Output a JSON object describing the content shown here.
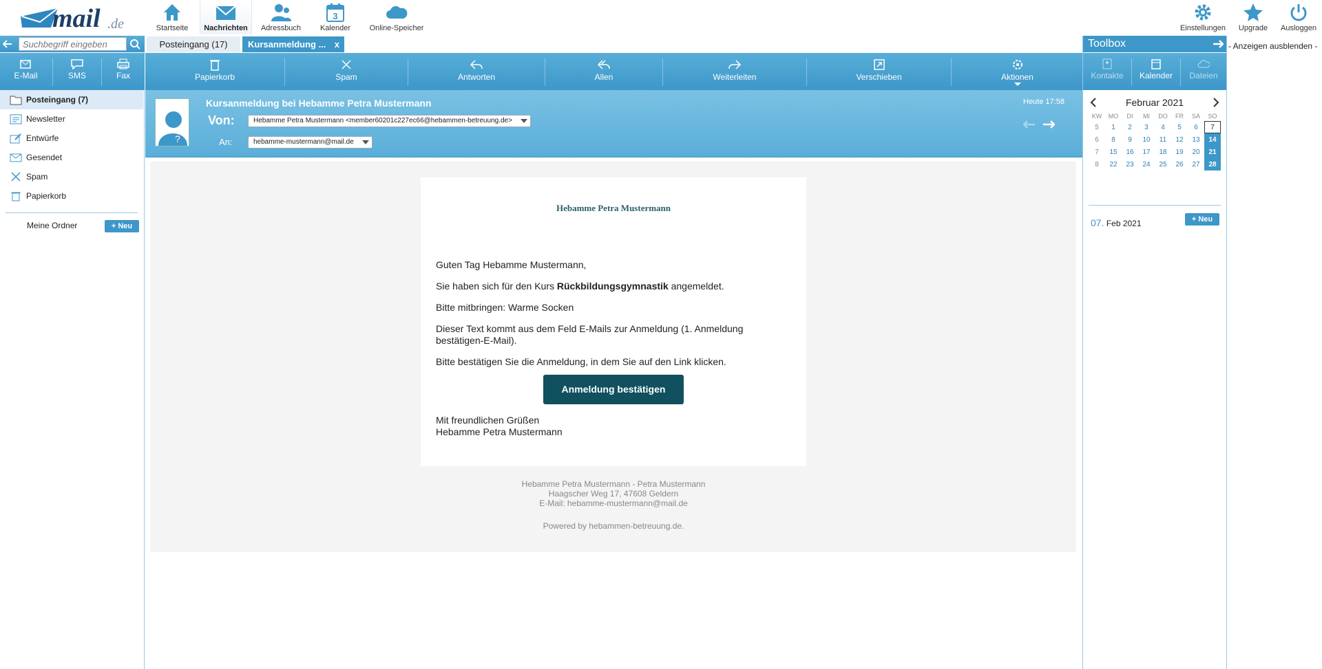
{
  "logo": {
    "word": "mail",
    "tld": ".de"
  },
  "nav": [
    {
      "label": "Startseite",
      "icon": "home-icon"
    },
    {
      "label": "Nachrichten",
      "icon": "envelope-icon",
      "active": true
    },
    {
      "label": "Adressbuch",
      "icon": "contacts-icon"
    },
    {
      "label": "Kalender",
      "icon": "calendar-icon",
      "badge": "3"
    },
    {
      "label": "Online-Speicher",
      "icon": "cloud-icon"
    }
  ],
  "nav_right": [
    {
      "label": "Einstellungen",
      "icon": "gear-icon"
    },
    {
      "label": "Upgrade",
      "icon": "star-icon"
    },
    {
      "label": "Ausloggen",
      "icon": "power-icon"
    }
  ],
  "search": {
    "placeholder": "Suchbegriff eingeben"
  },
  "tabs": [
    {
      "label": "Posteingang (17)"
    },
    {
      "label": "Kursanmeldung ...",
      "close": "x",
      "active": true
    }
  ],
  "compose": [
    {
      "label": "E-Mail"
    },
    {
      "label": "SMS"
    },
    {
      "label": "Fax"
    }
  ],
  "folders": [
    {
      "label": "Posteingang (7)",
      "icon": "folder-icon",
      "selected": true
    },
    {
      "label": "Newsletter",
      "icon": "newsletter-icon"
    },
    {
      "label": "Entwürfe",
      "icon": "draft-icon"
    },
    {
      "label": "Gesendet",
      "icon": "sent-icon"
    },
    {
      "label": "Spam",
      "icon": "spam-icon"
    },
    {
      "label": "Papierkorb",
      "icon": "trash-icon"
    }
  ],
  "my_folders": {
    "label": "Meine Ordner",
    "new_label": "Neu"
  },
  "toolbar": [
    {
      "label": "Papierkorb",
      "icon": "trash-icon"
    },
    {
      "label": "Spam",
      "icon": "spam-x-icon"
    },
    {
      "label": "Antworten",
      "icon": "reply-icon"
    },
    {
      "label": "Allen",
      "icon": "reply-all-icon"
    },
    {
      "label": "Weiterleiten",
      "icon": "forward-icon"
    },
    {
      "label": "Verschieben",
      "icon": "move-icon"
    },
    {
      "label": "Aktionen",
      "icon": "gear-icon"
    }
  ],
  "message": {
    "subject": "Kursanmeldung bei Hebamme Petra Mustermann",
    "from_label": "Von:",
    "from": "Hebamme Petra Mustermann <member60201c227ec66@hebammen-betreuung.de>",
    "to_label": "An:",
    "to": "hebamme-mustermann@mail.de",
    "time": "Heute 17:58"
  },
  "email": {
    "brand": "Hebamme Petra Mustermann",
    "greeting": "Guten Tag Hebamme Mustermann,",
    "course_pre": "Sie haben sich für den Kurs ",
    "course": "Rückbildungsgymnastik",
    "course_post": " angemeldet.",
    "bring": "Bitte mitbringen: Warme Socken",
    "note_1": "Dieser Text kommt aus dem Feld E-Mails zur Anmeldung (1. Anmeldung",
    "note_2": "bestätigen-E-Mail).",
    "confirm_text": "Bitte bestätigen Sie die Anmeldung, in dem Sie auf den Link klicken.",
    "button": "Anmeldung bestätigen",
    "closing": "Mit freundlichen Grüßen",
    "signature": "Hebamme Petra Mustermann",
    "footer_1": "Hebamme Petra Mustermann - Petra Mustermann",
    "footer_2": "Haagscher Weg 17, 47608 Geldern",
    "footer_3": "E-Mail: hebamme-mustermann@mail.de",
    "powered": "Powered by hebammen-betreuung.de."
  },
  "toolbox": {
    "title": "Toolbox",
    "hide": "- Anzeigen ausblenden -",
    "tabs": [
      {
        "label": "Kontakte"
      },
      {
        "label": "Kalender",
        "active": true
      },
      {
        "label": "Dateien"
      }
    ],
    "month": "Februar 2021",
    "weekdays": [
      "KW",
      "MO",
      "DI",
      "MI",
      "DO",
      "FR",
      "SA",
      "SO"
    ],
    "weeks": [
      [
        "5",
        "1",
        "2",
        "3",
        "4",
        "5",
        "6",
        "7"
      ],
      [
        "6",
        "8",
        "9",
        "10",
        "11",
        "12",
        "13",
        "14"
      ],
      [
        "7",
        "15",
        "16",
        "17",
        "18",
        "19",
        "20",
        "21"
      ],
      [
        "8",
        "22",
        "23",
        "24",
        "25",
        "26",
        "27",
        "28"
      ]
    ],
    "event_day": "07.",
    "event_month": "Feb 2021",
    "new_label": "Neu"
  },
  "colors": {
    "accent": "#3d97c9",
    "button": "#11505f",
    "brand": "#2a5f6b"
  }
}
